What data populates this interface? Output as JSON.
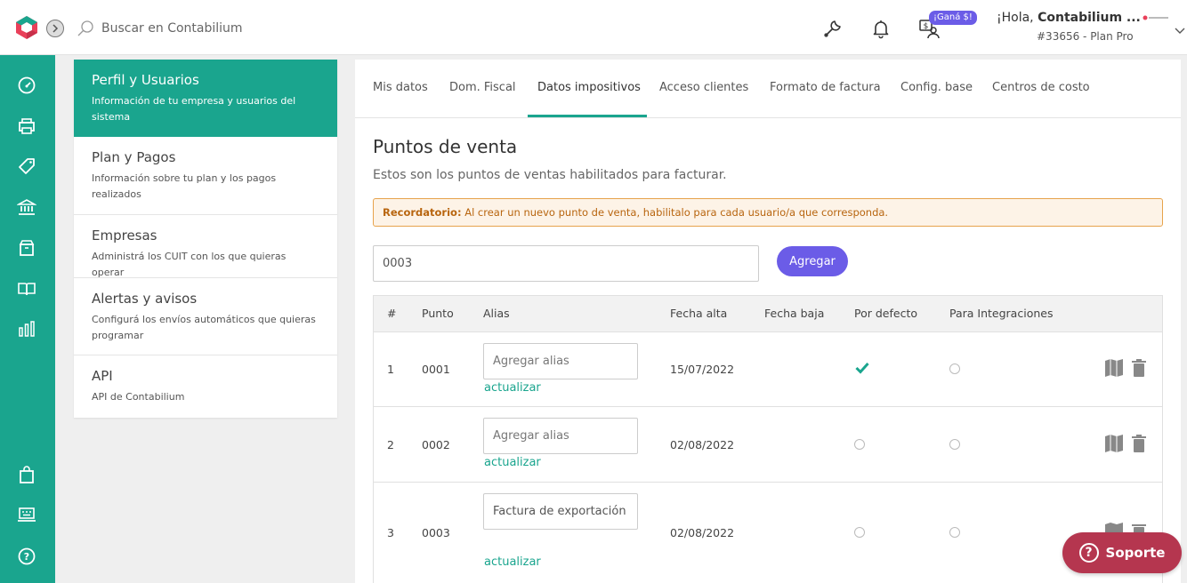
{
  "topbar": {
    "search_placeholder": "Buscar en Contabilium",
    "promo_badge": "¡Ganá $!",
    "greeting_prefix": "¡Hola, ",
    "user_name": "Contabilium ...",
    "account_line": "#33656 - Plan Pro",
    "brand_accent": "#1aa58e",
    "brand_secondary": "#e9405a",
    "icons": [
      "tools-icon",
      "bell-icon",
      "referral-icon"
    ]
  },
  "sidebar": {
    "color": "#1aa58e",
    "icons": [
      "dashboard-icon",
      "printer-icon",
      "tag-icon",
      "bank-icon",
      "archive-icon",
      "book-icon",
      "chart-icon",
      "shopping-bag-icon",
      "keyboard-icon",
      "help-icon"
    ]
  },
  "settings_menu": {
    "items": [
      {
        "title": "Perfil y Usuarios",
        "desc": "Información de tu empresa y usuarios del sistema",
        "active": true
      },
      {
        "title": "Plan y Pagos",
        "desc": "Información sobre tu plan y los pagos realizados"
      },
      {
        "title": "Empresas",
        "desc": "Administrá los CUIT con los que quieras operar"
      },
      {
        "title": "Alertas y avisos",
        "desc": "Configurá los envíos automáticos que quieras programar"
      },
      {
        "title": "API",
        "desc": "API de Contabilium"
      }
    ]
  },
  "tabs": {
    "items": [
      "Mis datos",
      "Dom. Fiscal",
      "Datos impositivos",
      "Acceso clientes",
      "Formato de factura",
      "Config. base",
      "Centros de costo"
    ],
    "active": "Datos impositivos"
  },
  "content": {
    "title": "Puntos de venta",
    "subtitle": "Estos son los puntos de ventas habilitados para facturar.",
    "reminder_label": "Recordatorio:",
    "reminder_text": " Al crear un nuevo punto de venta, habilitalo para cada usuario/a que corresponda.",
    "new_point_value": "0003",
    "add_label": "Agregar"
  },
  "table": {
    "headers": [
      "#",
      "Punto",
      "Alias",
      "Fecha alta",
      "Fecha baja",
      "Por defecto",
      "Para Integraciones"
    ],
    "rows": [
      {
        "n": "1",
        "punto": "0001",
        "alias_value": "",
        "alias_placeholder": "Agregar alias",
        "update": "actualizar",
        "fecha_alta": "15/07/2022",
        "fecha_baja": "",
        "por_defecto": true,
        "integraciones": false
      },
      {
        "n": "2",
        "punto": "0002",
        "alias_value": "",
        "alias_placeholder": "Agregar alias",
        "update": "actualizar",
        "fecha_alta": "02/08/2022",
        "fecha_baja": "",
        "por_defecto": false,
        "integraciones": false
      },
      {
        "n": "3",
        "punto": "0003",
        "alias_value": "Factura de exportación",
        "alias_placeholder": "Agregar alias",
        "update": "actualizar",
        "fecha_alta": "02/08/2022",
        "fecha_baja": "",
        "por_defecto": false,
        "integraciones": false
      }
    ]
  },
  "support": {
    "label": "Soporte",
    "color": "#b5364f"
  }
}
